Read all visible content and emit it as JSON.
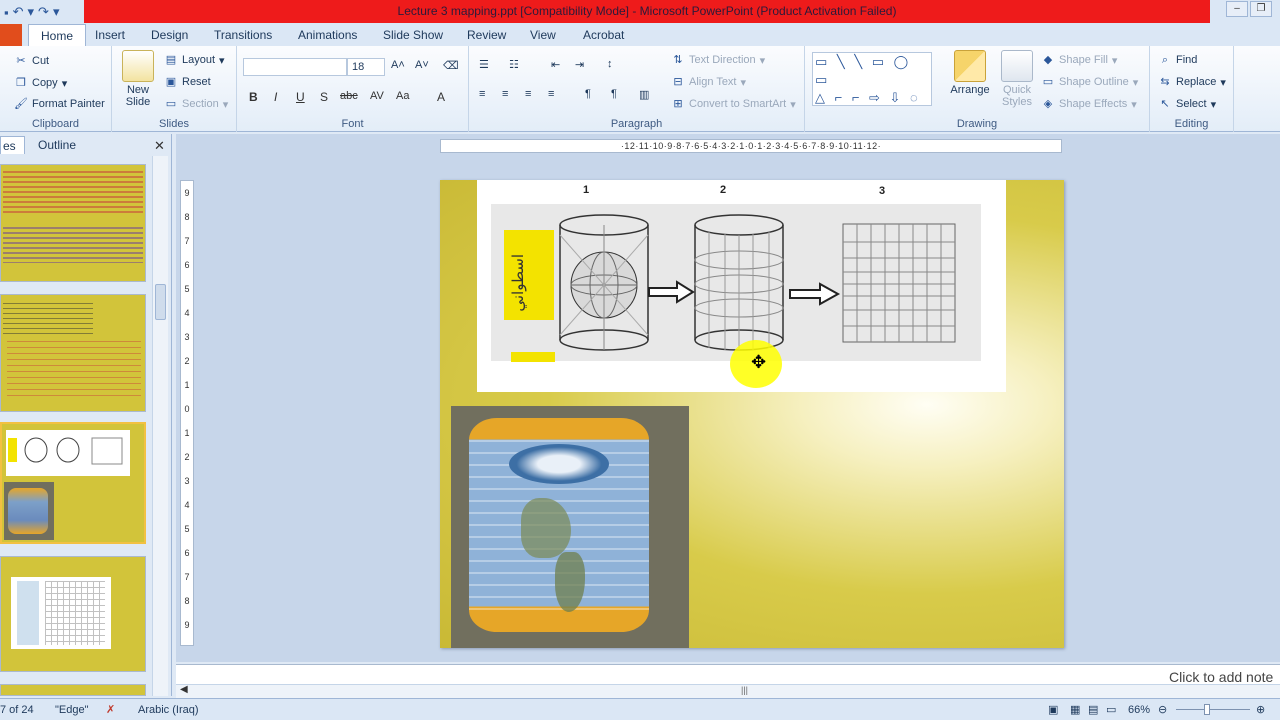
{
  "window": {
    "title": "Lecture 3 mapping.ppt [Compatibility Mode]  -  Microsoft PowerPoint (Product Activation Failed)"
  },
  "tabs": [
    "Home",
    "Insert",
    "Design",
    "Transitions",
    "Animations",
    "Slide Show",
    "Review",
    "View",
    "Acrobat"
  ],
  "ribbon": {
    "clipboard": {
      "label": "Clipboard",
      "cut": "Cut",
      "copy": "Copy",
      "format_painter": "Format Painter"
    },
    "slides": {
      "label": "Slides",
      "new_slide": "New Slide",
      "layout": "Layout",
      "reset": "Reset",
      "section": "Section"
    },
    "font": {
      "label": "Font",
      "font_name": "",
      "font_size": "18"
    },
    "paragraph": {
      "label": "Paragraph",
      "text_direction": "Text Direction",
      "align_text": "Align Text",
      "convert_smartart": "Convert to SmartArt"
    },
    "drawing": {
      "label": "Drawing",
      "arrange": "Arrange",
      "quick_styles": "Quick Styles",
      "shape_fill": "Shape Fill",
      "shape_outline": "Shape Outline",
      "shape_effects": "Shape Effects"
    },
    "editing": {
      "label": "Editing",
      "find": "Find",
      "replace": "Replace",
      "select": "Select"
    }
  },
  "left_pane": {
    "tab_slides": "es",
    "tab_outline": "Outline"
  },
  "ruler": {
    "horizontal": "·12·11·10·9·8·7·6·5·4·3·2·1·0·1·2·3·4·5·6·7·8·9·10·11·12·",
    "vertical": [
      "9",
      "8",
      "7",
      "6",
      "5",
      "4",
      "3",
      "2",
      "1",
      "0",
      "1",
      "2",
      "3",
      "4",
      "5",
      "6",
      "7",
      "8",
      "9"
    ]
  },
  "slide": {
    "labels": [
      "1",
      "2",
      "3"
    ],
    "arabic_text": "اسطواني"
  },
  "notes": {
    "placeholder": "Click to add note"
  },
  "status": {
    "slide_info": "7 of 24",
    "theme": "\"Edge\"",
    "language": "Arabic (Iraq)",
    "zoom": "66%"
  },
  "colors": {
    "accent_red": "#ee1b1b",
    "slide_yellow": "#d8cb4a"
  }
}
